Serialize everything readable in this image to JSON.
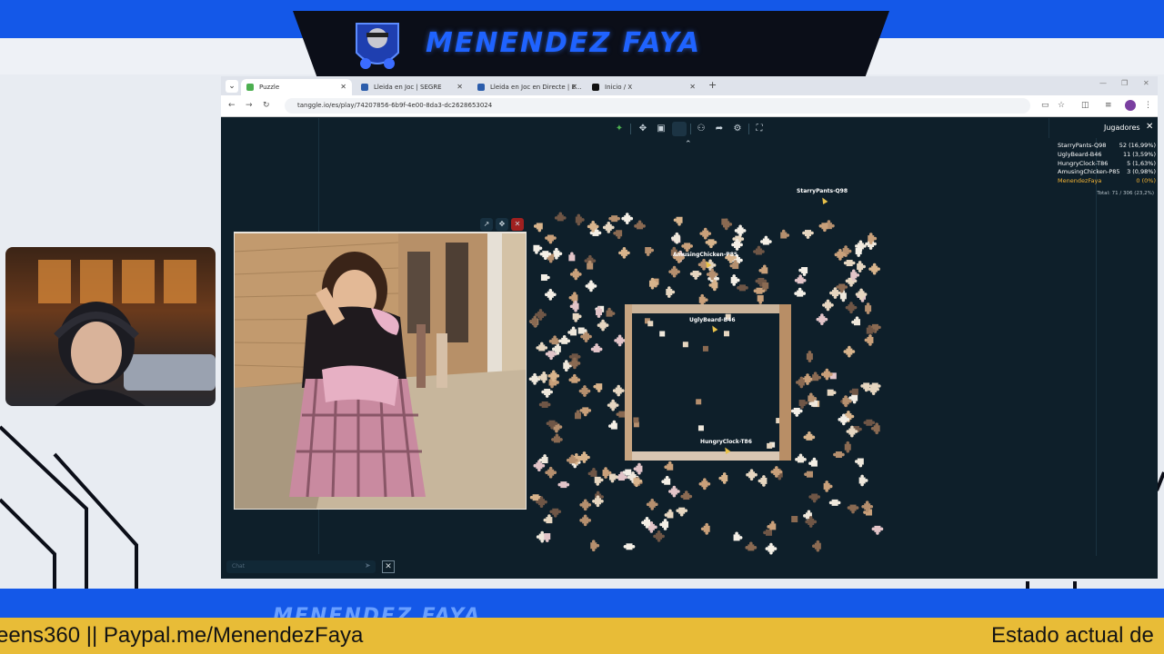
{
  "stream": {
    "channel_title": "MENENDEZ FAYA",
    "ticker_left": "eens360 || Paypal.me/MenendezFaya",
    "ticker_right": "Estado actual de",
    "bottom_band_text": "MENENDEZ FAYA"
  },
  "browser": {
    "tabs": [
      {
        "label": "Puzzle",
        "active": true,
        "favicon_color": "#4caf50"
      },
      {
        "label": "Lleida en Joc | SEGRE",
        "active": false,
        "favicon_color": "#2a5cab"
      },
      {
        "label": "Lleida en Joc en Directe | E...",
        "active": false,
        "favicon_color": "#2a5cab"
      },
      {
        "label": "Inicio / X",
        "active": false,
        "favicon_color": "#111111"
      }
    ],
    "url": "tanggle.io/es/play/74207856-6b9f-4e00-8da3-dc2628653024"
  },
  "game": {
    "players_title": "Jugadores",
    "players": [
      {
        "name": "StarryPants-Q98",
        "score": "52 (16,99%)",
        "is_me": false
      },
      {
        "name": "UglyBeard-B46",
        "score": "11 (3,59%)",
        "is_me": false
      },
      {
        "name": "HungryClock-T86",
        "score": "5 (1,63%)",
        "is_me": false
      },
      {
        "name": "AmusingChicken-P85",
        "score": "3 (0,98%)",
        "is_me": false
      },
      {
        "name": "MenendezFaya",
        "score": "0 (0%)",
        "is_me": true
      }
    ],
    "total": "Total: 71 / 306 (23,2%)",
    "cursors": [
      {
        "label": "StarryPants-Q98"
      },
      {
        "label": "AmusingChicken-P85"
      },
      {
        "label": "UglyBeard-B46"
      },
      {
        "label": "HungryClock-T86"
      }
    ],
    "chat_placeholder": "Chat"
  },
  "colors": {
    "accent_blue": "#1458e8",
    "ticker_yellow": "#e8bc37",
    "game_bg": "#0e1f2a",
    "me_highlight": "#f2b233"
  }
}
